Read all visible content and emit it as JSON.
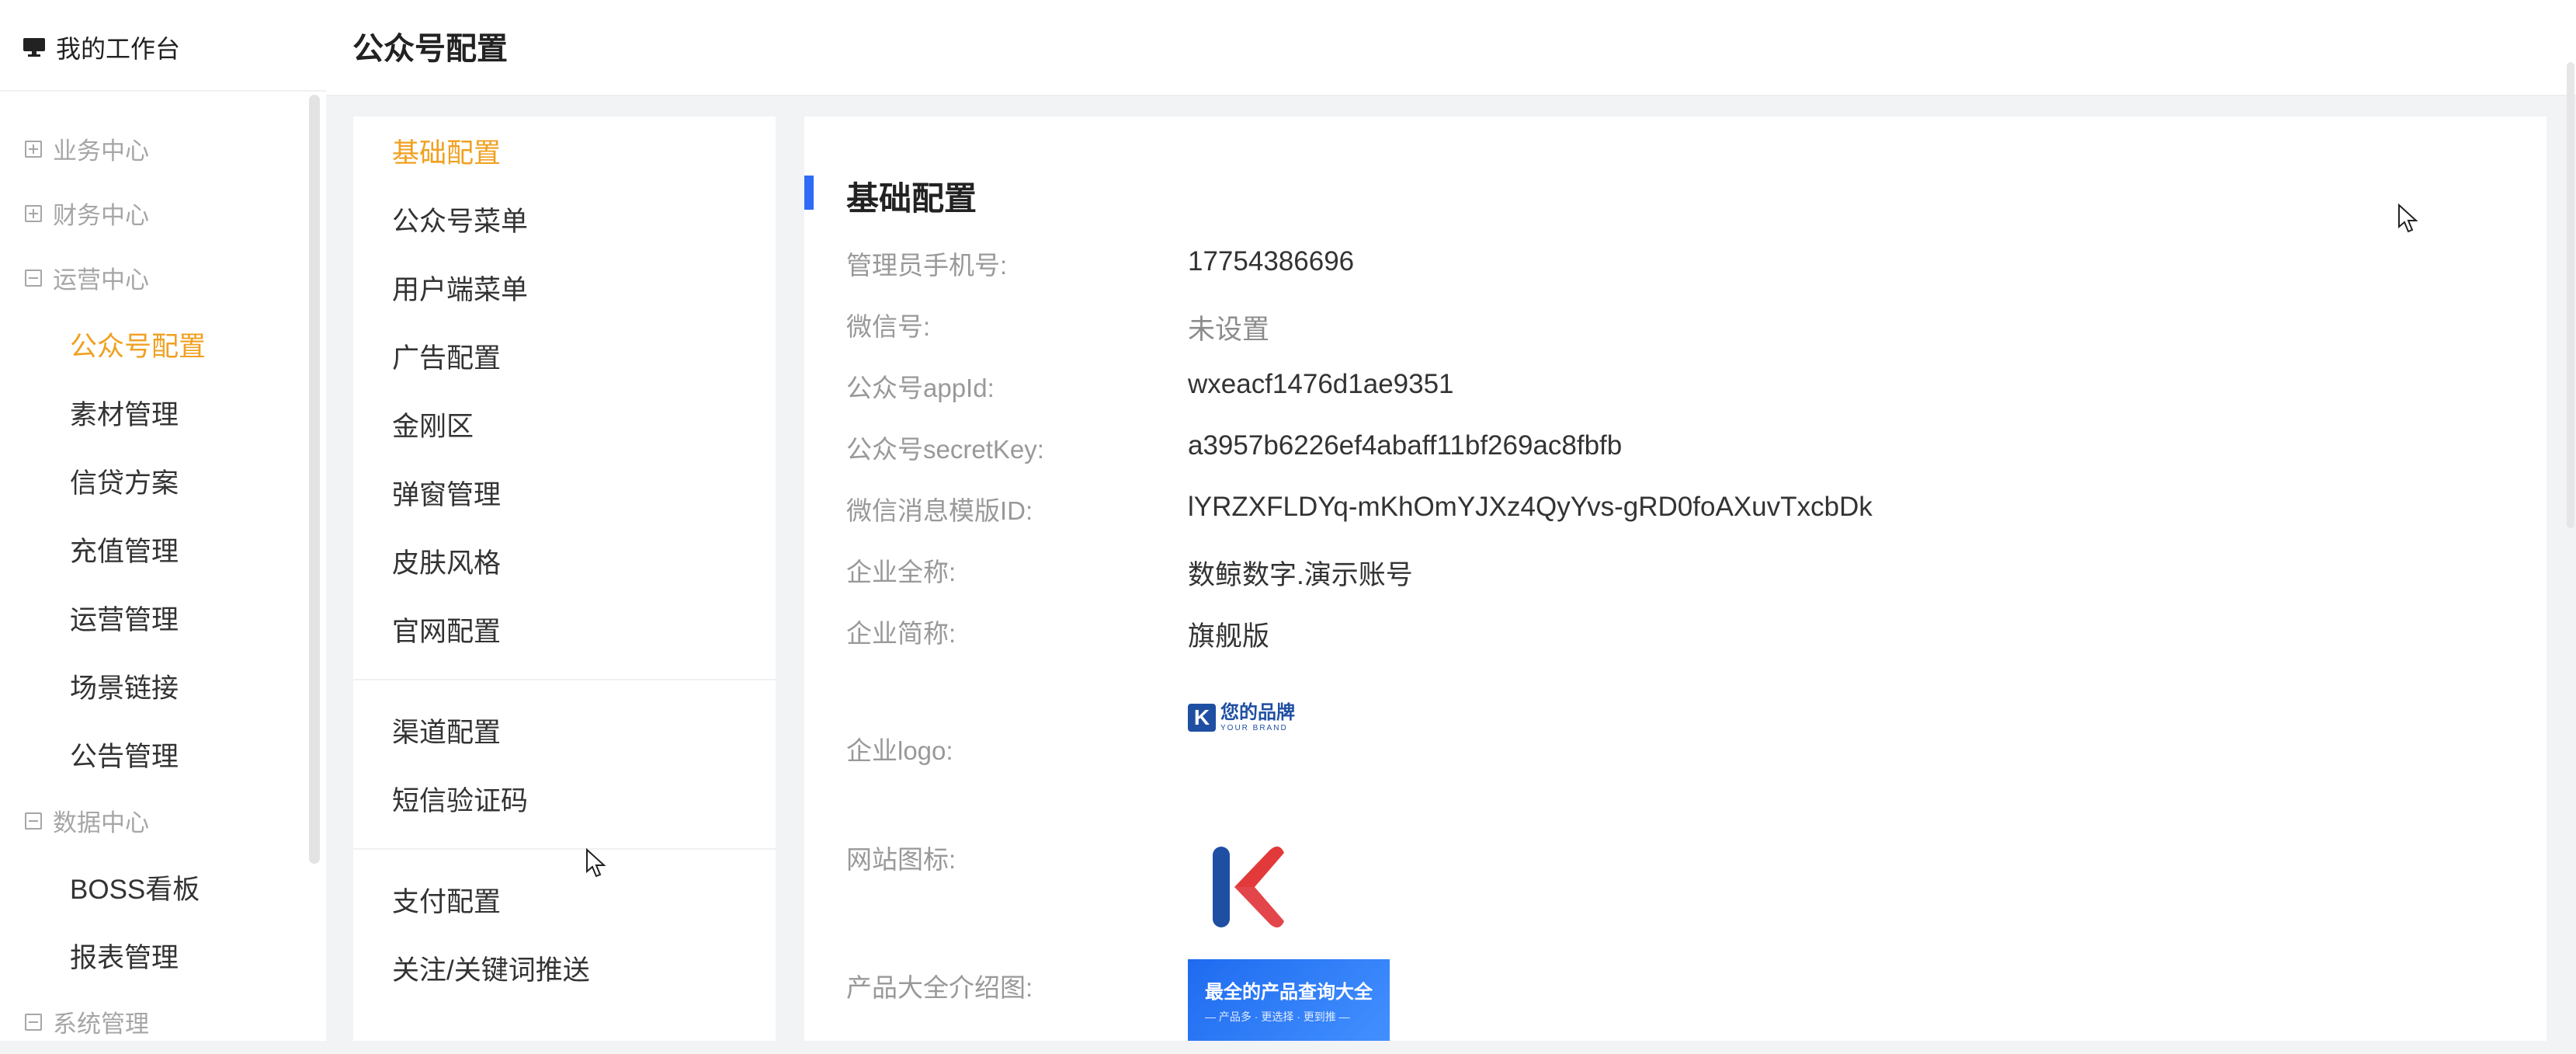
{
  "sidebar": {
    "workbench_label": "我的工作台",
    "menu": [
      {
        "type": "group",
        "label": "业务中心",
        "expanded": false
      },
      {
        "type": "group",
        "label": "财务中心",
        "expanded": false
      },
      {
        "type": "group",
        "label": "运营中心",
        "expanded": true
      },
      {
        "type": "item",
        "label": "公众号配置",
        "active": true
      },
      {
        "type": "item",
        "label": "素材管理"
      },
      {
        "type": "item",
        "label": "信贷方案"
      },
      {
        "type": "item",
        "label": "充值管理"
      },
      {
        "type": "item",
        "label": "运营管理"
      },
      {
        "type": "item",
        "label": "场景链接"
      },
      {
        "type": "item",
        "label": "公告管理"
      },
      {
        "type": "group",
        "label": "数据中心",
        "expanded": true
      },
      {
        "type": "item",
        "label": "BOSS看板"
      },
      {
        "type": "item",
        "label": "报表管理"
      },
      {
        "type": "group",
        "label": "系统管理",
        "expanded": true
      }
    ]
  },
  "header": {
    "title": "公众号配置"
  },
  "subnav": {
    "groups": [
      [
        "基础配置",
        "公众号菜单",
        "用户端菜单",
        "广告配置",
        "金刚区",
        "弹窗管理",
        "皮肤风格",
        "官网配置"
      ],
      [
        "渠道配置",
        "短信验证码"
      ],
      [
        "支付配置",
        "关注/关键词推送"
      ]
    ],
    "active": "基础配置"
  },
  "content": {
    "section_title": "基础配置",
    "fields": [
      {
        "label": "管理员手机号:",
        "value": "17754386696"
      },
      {
        "label": "微信号:",
        "value": "未设置",
        "muted": true
      },
      {
        "label": "公众号appId:",
        "value": "wxeacf1476d1ae9351"
      },
      {
        "label": "公众号secretKey:",
        "value": "a3957b6226ef4abaff11bf269ac8fbfb"
      },
      {
        "label": "微信消息模版ID:",
        "value": "lYRZXFLDYq-mKhOmYJXz4QyYvs-gRD0foAXuvTxcbDk"
      },
      {
        "label": "企业全称:",
        "value": "数鲸数字.演示账号"
      },
      {
        "label": "企业简称:",
        "value": "旗舰版"
      }
    ],
    "logo_label": "企业logo:",
    "logo": {
      "mark": "K",
      "brand_cn": "您的品牌",
      "brand_en": "YOUR BRAND"
    },
    "favicon_label": "网站图标:",
    "favicon_icon": "k-logo-icon",
    "product_label": "产品大全介绍图:",
    "banner": {
      "title": "最全的产品查询大全",
      "subtitle": "— 产品多 · 更选择 · 更到推 —"
    }
  },
  "colors": {
    "accent": "#f0a020",
    "section_bar": "#2f6bf5",
    "brand": "#1f4fa3"
  }
}
